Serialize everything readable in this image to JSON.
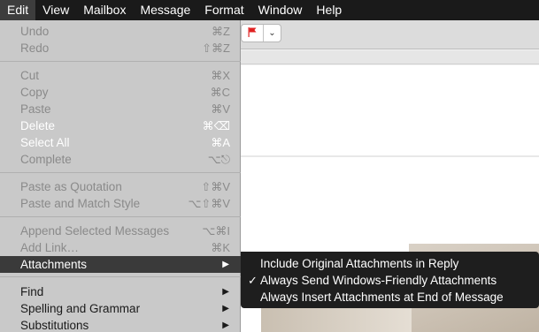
{
  "menubar": {
    "items": [
      {
        "label": "Edit"
      },
      {
        "label": "View"
      },
      {
        "label": "Mailbox"
      },
      {
        "label": "Message"
      },
      {
        "label": "Format"
      },
      {
        "label": "Window"
      },
      {
        "label": "Help"
      }
    ]
  },
  "toolbar": {
    "flag_icon": "flag-icon",
    "flag_color": "#e02020",
    "dropdown_icon": "chevron-down-icon",
    "dropdown_glyph": "⌄"
  },
  "edit_menu": {
    "undo": {
      "label": "Undo",
      "shortcut": "⌘Z"
    },
    "redo": {
      "label": "Redo",
      "shortcut": "⇧⌘Z"
    },
    "cut": {
      "label": "Cut",
      "shortcut": "⌘X"
    },
    "copy": {
      "label": "Copy",
      "shortcut": "⌘C"
    },
    "paste": {
      "label": "Paste",
      "shortcut": "⌘V"
    },
    "delete": {
      "label": "Delete",
      "shortcut": "⌘⌫"
    },
    "select_all": {
      "label": "Select All",
      "shortcut": "⌘A"
    },
    "complete": {
      "label": "Complete",
      "shortcut": "⌥⎋"
    },
    "paste_quotation": {
      "label": "Paste as Quotation",
      "shortcut": "⇧⌘V"
    },
    "paste_match": {
      "label": "Paste and Match Style",
      "shortcut": "⌥⇧⌘V"
    },
    "append": {
      "label": "Append Selected Messages",
      "shortcut": "⌥⌘I"
    },
    "add_link": {
      "label": "Add Link…",
      "shortcut": "⌘K"
    },
    "attachments": {
      "label": "Attachments"
    },
    "find": {
      "label": "Find"
    },
    "spelling": {
      "label": "Spelling and Grammar"
    },
    "substitutions": {
      "label": "Substitutions"
    }
  },
  "attachments_submenu": {
    "include_original": {
      "label": "Include Original Attachments in Reply"
    },
    "windows_friendly": {
      "label": "Always Send Windows-Friendly Attachments",
      "checked": true,
      "check": "✓"
    },
    "insert_end": {
      "label": "Always Insert Attachments at End of Message"
    }
  },
  "submenu_arrow": "▶"
}
